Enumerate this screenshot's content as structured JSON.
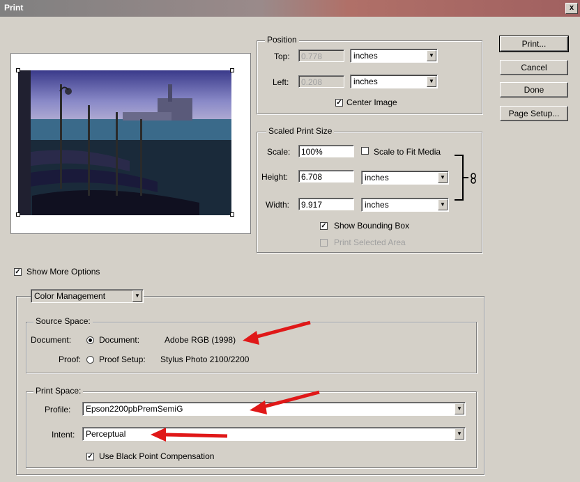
{
  "window": {
    "title": "Print",
    "close_glyph": "x"
  },
  "buttons": {
    "print": "Print...",
    "cancel": "Cancel",
    "done": "Done",
    "page_setup": "Page Setup..."
  },
  "position": {
    "group_title": "Position",
    "top_label": "Top:",
    "top_value": "0.778",
    "top_unit": "inches",
    "left_label": "Left:",
    "left_value": "0.208",
    "left_unit": "inches",
    "center_image": "Center Image"
  },
  "scaled": {
    "group_title": "Scaled Print Size",
    "scale_label": "Scale:",
    "scale_value": "100%",
    "scale_to_fit": "Scale to Fit Media",
    "height_label": "Height:",
    "height_value": "6.708",
    "height_unit": "inches",
    "width_label": "Width:",
    "width_value": "9.917",
    "width_unit": "inches",
    "show_bounding_box": "Show Bounding Box",
    "print_selected_area": "Print Selected Area"
  },
  "options": {
    "show_more": "Show More Options",
    "section_select": "Color Management"
  },
  "source": {
    "group_title": "Source Space:",
    "document_label": "Document:",
    "document_option": "Document:",
    "document_profile": "Adobe RGB (1998)",
    "proof_label": "Proof:",
    "proof_option": "Proof Setup:",
    "proof_profile": "Stylus Photo 2100/2200"
  },
  "print_space": {
    "group_title": "Print Space:",
    "profile_label": "Profile:",
    "profile_value": "Epson2200pbPremSemiG",
    "intent_label": "Intent:",
    "intent_value": "Perceptual",
    "black_point": "Use Black Point Compensation"
  },
  "colors": {
    "annotation_arrow": "#e01818",
    "titlebar": "#808080"
  }
}
